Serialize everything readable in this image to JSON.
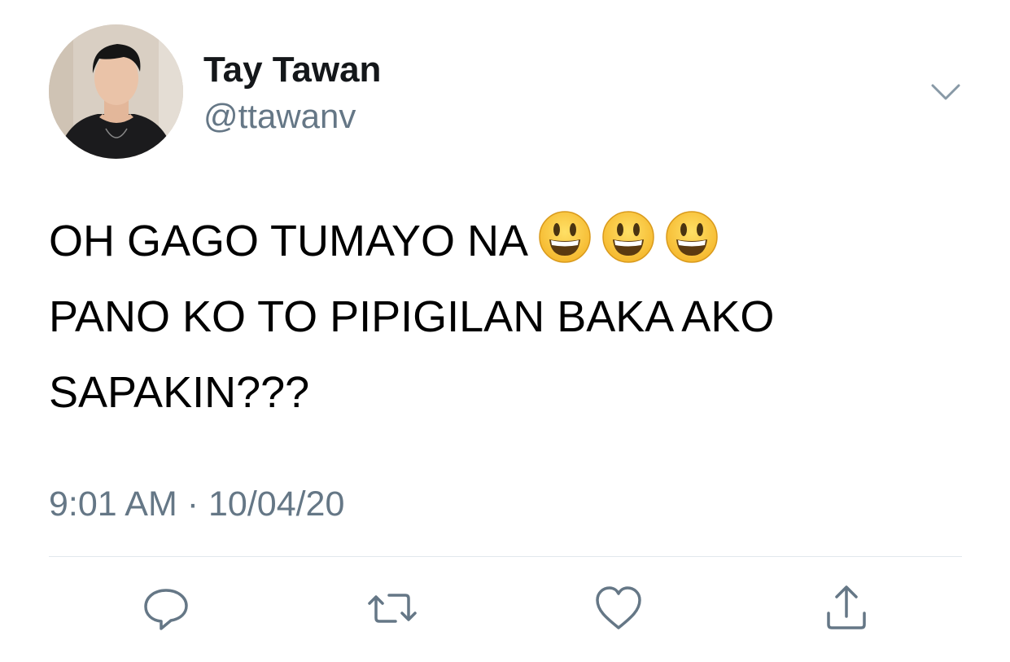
{
  "user": {
    "display_name": "Tay Tawan",
    "handle": "@ttawanv"
  },
  "tweet": {
    "line1": "OH GAGO TUMAYO NA",
    "line1_emojis": [
      "smiley-emoji",
      "smiley-emoji",
      "smiley-emoji"
    ],
    "line2": "PANO KO TO PIPIGILAN BAKA AKO",
    "line3": "SAPAKIN???",
    "time": "9:01 AM",
    "separator": "·",
    "date": "10/04/20"
  },
  "icons": {
    "menu": "chevron-down-icon",
    "reply": "reply-icon",
    "retweet": "retweet-icon",
    "like": "heart-icon",
    "share": "share-icon"
  },
  "colors": {
    "text": "#14171a",
    "secondary": "#657786",
    "divider": "#e1e8ed",
    "action_icon": "#1da1f2"
  }
}
